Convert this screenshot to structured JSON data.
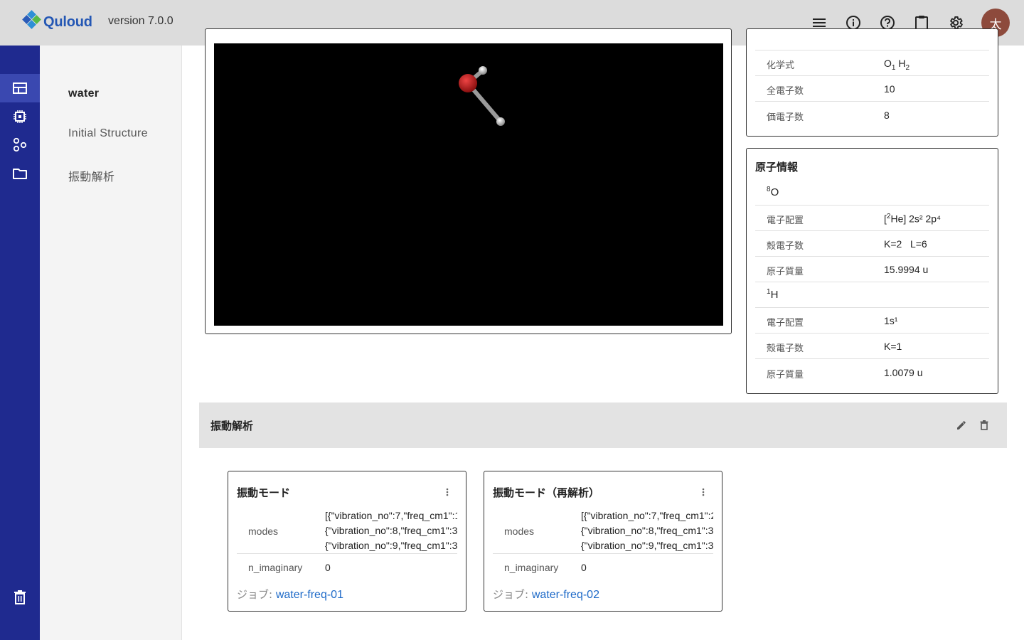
{
  "header": {
    "app_name": "Quloud",
    "version": "version 7.0.0",
    "icons": [
      "menu-icon",
      "info-icon",
      "help-icon",
      "clipboard-icon",
      "settings-icon"
    ],
    "avatar_initial": "太"
  },
  "rail": {
    "items": [
      "table-icon",
      "chip-icon",
      "molecule-icon",
      "folder-icon"
    ],
    "bottom": "trash-icon",
    "active_index": 0
  },
  "subnav": {
    "items": [
      {
        "label": "water"
      },
      {
        "label": "Initial Structure"
      },
      {
        "label": "振動解析"
      }
    ]
  },
  "molecule_props": {
    "rows": [
      {
        "key": "化学式",
        "value_parts": [
          "O",
          "1",
          "H",
          "2"
        ]
      },
      {
        "key": "全電子数",
        "value": "10"
      },
      {
        "key": "価電子数",
        "value": "8"
      }
    ]
  },
  "atom_info": {
    "title": "原子情報",
    "atoms": [
      {
        "mass_number": "8",
        "symbol": "O",
        "rows": [
          {
            "key": "電子配置",
            "value_core_mass": "2",
            "value_core": "He]",
            "value_rest": " 2s² 2p⁴"
          },
          {
            "key": "殻電子数",
            "value": "K=2   L=6"
          },
          {
            "key": "原子質量",
            "value": "15.9994 u"
          }
        ]
      },
      {
        "mass_number": "1",
        "symbol": "H",
        "rows": [
          {
            "key": "電子配置",
            "value": "1s¹"
          },
          {
            "key": "殻電子数",
            "value": "K=1"
          },
          {
            "key": "原子質量",
            "value": "1.0079 u"
          }
        ]
      }
    ]
  },
  "section": {
    "title": "振動解析",
    "actions": [
      "edit-icon",
      "delete-icon"
    ]
  },
  "results": [
    {
      "title": "振動モード",
      "modes_key": "modes",
      "modes_lines": [
        "[{\"vibration_no\":7,\"freq_cm1\":1",
        "{\"vibration_no\":8,\"freq_cm1\":3",
        "{\"vibration_no\":9,\"freq_cm1\":3"
      ],
      "imag_key": "n_imaginary",
      "imag_value": "0",
      "job_label": "ジョブ: ",
      "job_link": "water-freq-01"
    },
    {
      "title": "振動モード（再解析）",
      "modes_key": "modes",
      "modes_lines": [
        "[{\"vibration_no\":7,\"freq_cm1\":2",
        "{\"vibration_no\":8,\"freq_cm1\":3",
        "{\"vibration_no\":9,\"freq_cm1\":3"
      ],
      "imag_key": "n_imaginary",
      "imag_value": "0",
      "job_label": "ジョブ: ",
      "job_link": "water-freq-02"
    }
  ]
}
